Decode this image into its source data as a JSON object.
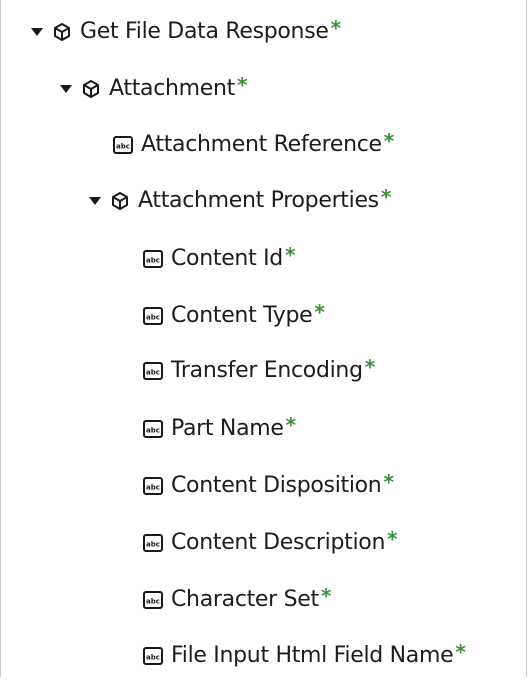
{
  "tree": {
    "required_marker": "*",
    "accent_color": "#3d8f3d",
    "nodes": [
      {
        "label": "Get File Data Response",
        "icon": "cube-icon",
        "expanded": true
      },
      {
        "label": "Attachment",
        "icon": "cube-icon",
        "expanded": true
      },
      {
        "label": "Attachment Reference",
        "icon": "abc-field-icon"
      },
      {
        "label": "Attachment Properties",
        "icon": "cube-icon",
        "expanded": true
      },
      {
        "label": "Content Id",
        "icon": "abc-field-icon"
      },
      {
        "label": "Content Type",
        "icon": "abc-field-icon"
      },
      {
        "label": "Transfer Encoding",
        "icon": "abc-field-icon"
      },
      {
        "label": "Part Name",
        "icon": "abc-field-icon"
      },
      {
        "label": "Content Disposition",
        "icon": "abc-field-icon"
      },
      {
        "label": "Content Description",
        "icon": "abc-field-icon"
      },
      {
        "label": "Character Set",
        "icon": "abc-field-icon"
      },
      {
        "label": "File Input Html Field Name",
        "icon": "abc-field-icon"
      }
    ]
  }
}
